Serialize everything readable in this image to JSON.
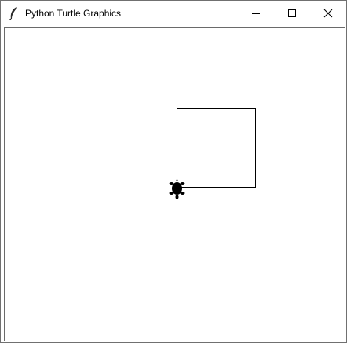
{
  "window": {
    "title": "Python Turtle Graphics",
    "app_icon": "feather-icon",
    "controls": {
      "minimize_icon": "minimize-icon",
      "maximize_icon": "maximize-icon",
      "close_icon": "close-icon"
    }
  },
  "canvas": {
    "background": "#ffffff",
    "pen_color": "#000000",
    "turtle_color": "#000000",
    "turtle_shape": "turtle",
    "turtle_heading": "down",
    "drawing": "square"
  }
}
